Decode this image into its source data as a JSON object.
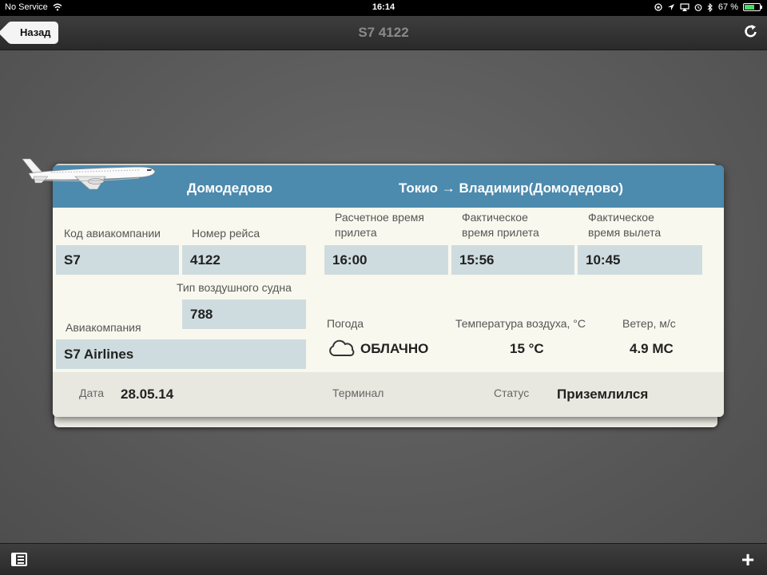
{
  "status_bar": {
    "carrier": "No Service",
    "time": "16:14",
    "battery": "67 %",
    "battery_level": 0.67
  },
  "nav": {
    "back_label": "Назад",
    "title": "S7 4122"
  },
  "ticket": {
    "origin": "Домодедово",
    "route": "Токио → Владимир(Домодедово)",
    "airline_code_label": "Код авиакомпании",
    "airline_code": "S7",
    "flight_number_label": "Номер рейса",
    "flight_number": "4122",
    "aircraft_type_label": "Тип воздушного судна",
    "aircraft_type": "788",
    "airline_label": "Авиакомпания",
    "airline": "S7 Airlines",
    "est_arrival_label_1": "Расчетное время",
    "est_arrival_label_2": "прилета",
    "est_arrival": "16:00",
    "act_arrival_label_1": "Фактическое",
    "act_arrival_label_2": "время прилета",
    "act_arrival": "15:56",
    "act_departure_label_1": "Фактическое",
    "act_departure_label_2": "время вылета",
    "act_departure": "10:45",
    "weather_label": "Погода",
    "weather": "ОБЛАЧНО",
    "weather_icon": "cloud-icon",
    "temp_label": "Температура воздуха, °С",
    "temp": "15 °C",
    "wind_label": "Ветер, м/с",
    "wind": "4.9 MC",
    "date_label": "Дата",
    "date": "28.05.14",
    "terminal_label": "Терминал",
    "status_label": "Статус",
    "status": "Приземлился"
  },
  "colors": {
    "header_blue": "#4c8aae",
    "field_bg": "#cfdcdf",
    "ticket_bg": "#f9f8ee"
  }
}
